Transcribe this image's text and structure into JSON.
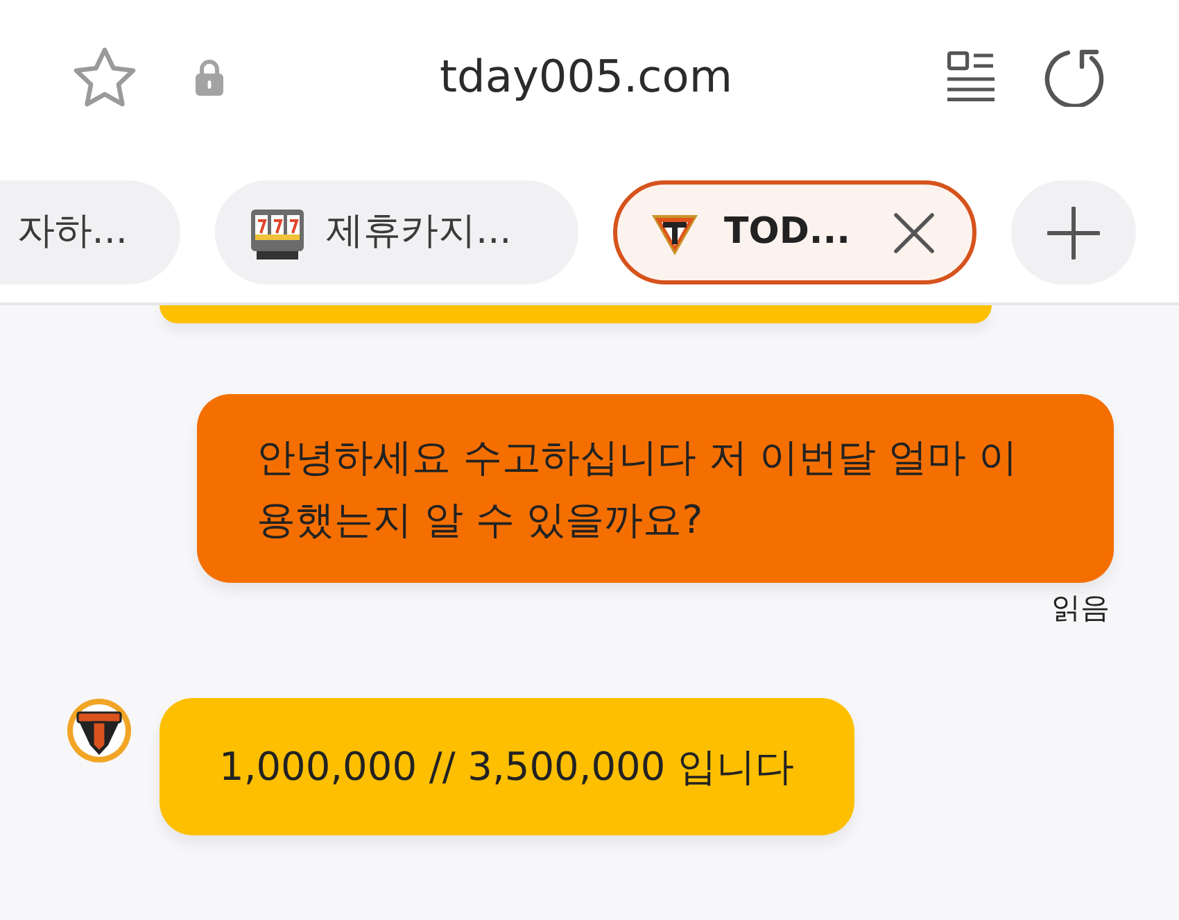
{
  "address_bar": {
    "url": "tday005.com",
    "bookmarked": false,
    "secure": true
  },
  "tabs": [
    {
      "title": "자하...",
      "selected": false
    },
    {
      "title": "제휴카지...",
      "selected": false
    },
    {
      "title": "TOD...",
      "selected": true
    }
  ],
  "messages": [
    {
      "kind": "clipped"
    },
    {
      "kind": "outgoing",
      "text": "안녕하세요 수고하십니다 저 이번달 얼마 이용했는지 알 수 있을까요?",
      "status": "읽음"
    },
    {
      "kind": "incoming",
      "text": "1,000,000 // 3,500,000 입니다"
    }
  ]
}
